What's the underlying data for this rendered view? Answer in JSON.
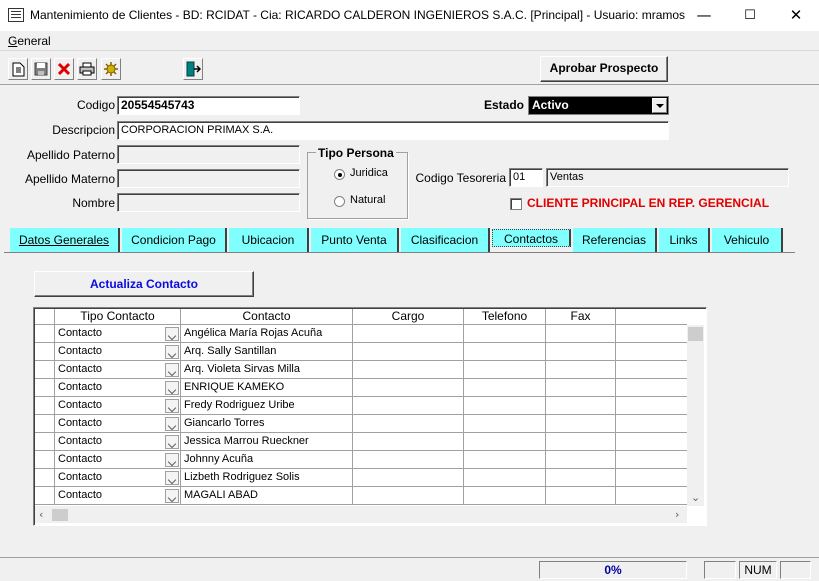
{
  "window": {
    "title": "Mantenimiento de Clientes - BD: RCIDAT - Cia: RICARDO CALDERON INGENIEROS S.A.C. [Principal] - Usuario: mramos",
    "min": "—",
    "max": "☐",
    "close": "✕"
  },
  "menu": {
    "general_first": "G",
    "general_rest": "eneral"
  },
  "toolbar": {
    "aprobar_label": "Aprobar Prospecto"
  },
  "form": {
    "codigo_label": "Codigo",
    "codigo_value": "20554545743",
    "estado_label": "Estado",
    "estado_value": "Activo",
    "descripcion_label": "Descripcion",
    "descripcion_value": "CORPORACION PRIMAX S.A.",
    "apellido_paterno_label": "Apellido Paterno",
    "apellido_paterno_value": "",
    "apellido_materno_label": "Apellido Materno",
    "apellido_materno_value": "",
    "nombre_label": "Nombre",
    "nombre_value": "",
    "tipo_persona_label": "Tipo Persona",
    "juridica_label": "Juridica",
    "natural_label": "Natural",
    "codigo_tesoreria_label": "Codigo Tesoreria",
    "codigo_tesoreria_code": "01",
    "codigo_tesoreria_desc": "Ventas",
    "cliente_principal_label": "CLIENTE PRINCIPAL EN REP. GERENCIAL"
  },
  "tabs": [
    {
      "label": "Datos Generales"
    },
    {
      "label": "Condicion Pago"
    },
    {
      "label": "Ubicacion"
    },
    {
      "label": "Punto Venta"
    },
    {
      "label": "Clasificacion"
    },
    {
      "label": "Contactos",
      "active": true
    },
    {
      "label": "Referencias"
    },
    {
      "label": "Links"
    },
    {
      "label": "Vehiculo"
    }
  ],
  "contactos": {
    "actualiza_label": "Actualiza Contacto",
    "columns": [
      "Tipo Contacto",
      "Contacto",
      "Cargo",
      "Telefono",
      "Fax"
    ],
    "rows": [
      {
        "tipo": "Contacto",
        "contacto": "Angélica María Rojas Acuña"
      },
      {
        "tipo": "Contacto",
        "contacto": "Arq. Sally Santillan"
      },
      {
        "tipo": "Contacto",
        "contacto": "Arq. Violeta Sirvas Milla"
      },
      {
        "tipo": "Contacto",
        "contacto": "ENRIQUE KAMEKO"
      },
      {
        "tipo": "Contacto",
        "contacto": "Fredy Rodriguez Uribe"
      },
      {
        "tipo": "Contacto",
        "contacto": "Giancarlo Torres"
      },
      {
        "tipo": "Contacto",
        "contacto": "Jessica Marrou Rueckner"
      },
      {
        "tipo": "Contacto",
        "contacto": "Johnny Acuña"
      },
      {
        "tipo": "Contacto",
        "contacto": "Lizbeth Rodriguez Solis"
      },
      {
        "tipo": "Contacto",
        "contacto": "MAGALI ABAD"
      }
    ]
  },
  "status": {
    "progress": "0%",
    "progress_fraction": 0,
    "num": "NUM"
  }
}
